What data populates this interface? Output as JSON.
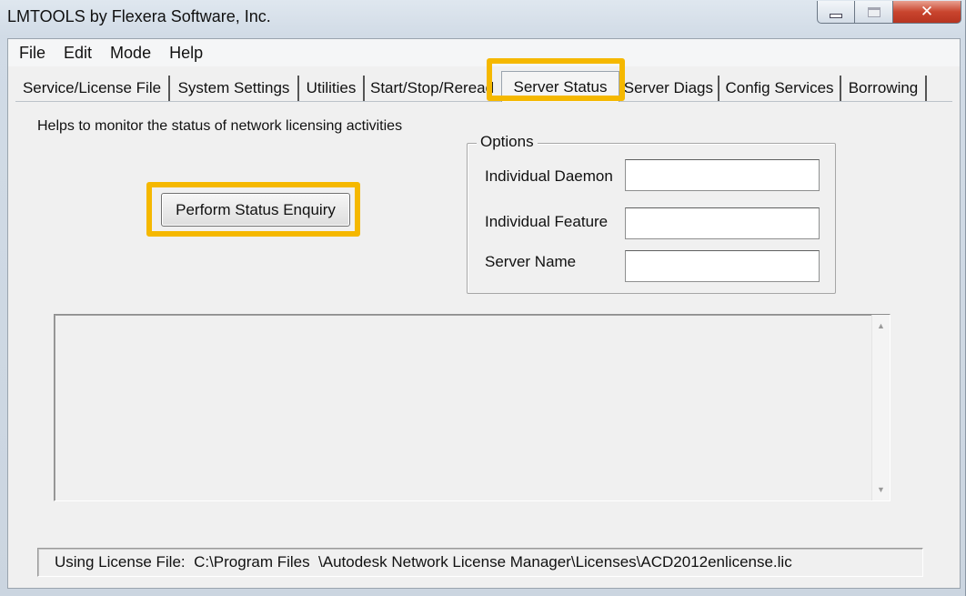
{
  "window": {
    "title": "LMTOOLS by Flexera Software, Inc.",
    "close_glyph": "✕"
  },
  "menu": [
    "File",
    "Edit",
    "Mode",
    "Help"
  ],
  "tabs": [
    {
      "label": "Service/License File"
    },
    {
      "label": "System Settings"
    },
    {
      "label": "Utilities"
    },
    {
      "label": "Start/Stop/Reread"
    },
    {
      "label": "Server Status",
      "selected": true
    },
    {
      "label": "Server Diags"
    },
    {
      "label": "Config Services"
    },
    {
      "label": "Borrowing"
    }
  ],
  "server_status": {
    "description": "Helps to monitor the status of network licensing activities",
    "enquiry_button": "Perform Status Enquiry",
    "options": {
      "legend": "Options",
      "individual_daemon_label": "Individual Daemon",
      "individual_daemon_value": "",
      "individual_feature_label": "Individual Feature",
      "individual_feature_value": "",
      "server_name_label": "Server Name",
      "server_name_value": ""
    },
    "output_text": "",
    "scroll_up": "▲",
    "scroll_down": "▼"
  },
  "status_bar": {
    "text": "Using License File:  C:\\Program Files  \\Autodesk Network License Manager\\Licenses\\ACD2012enlicense.lic"
  },
  "colors": {
    "highlight": "#f5b800",
    "close_button": "#c9452e"
  }
}
